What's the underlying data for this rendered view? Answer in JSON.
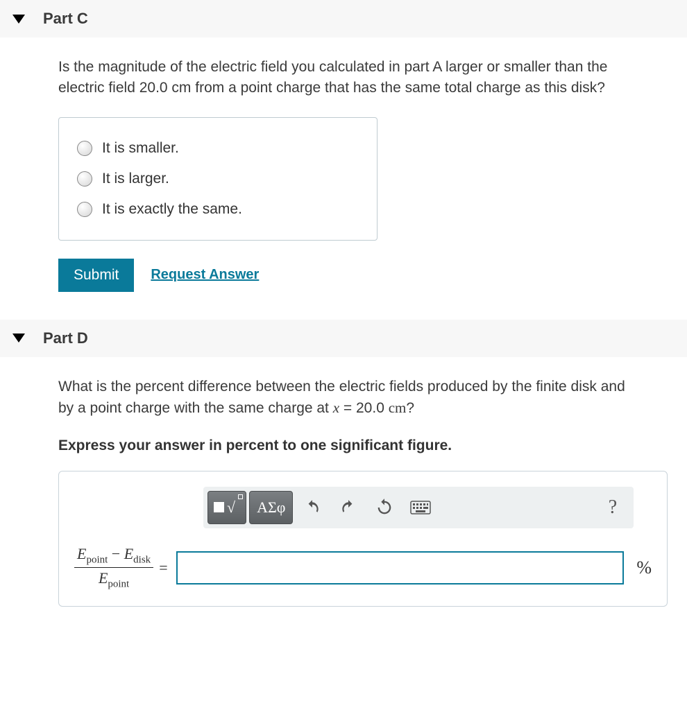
{
  "partC": {
    "label": "Part C",
    "question": "Is the magnitude of the electric field you calculated in part A larger or smaller than the electric field 20.0 cm from a point charge that has the same total charge as this disk?",
    "options": [
      "It is smaller.",
      "It is larger.",
      "It is exactly the same."
    ],
    "submit_label": "Submit",
    "request_label": "Request Answer"
  },
  "partD": {
    "label": "Part D",
    "question_pre": "What is the percent difference between the electric fields produced by the finite disk and by a point charge with the same charge at ",
    "question_var": "x",
    "question_eq": " = 20.0 ",
    "question_unit": "cm",
    "question_post": "?",
    "instruction": "Express your answer in percent to one significant figure.",
    "toolbar": {
      "greek": "ΑΣφ"
    },
    "expr": {
      "E": "E",
      "point": "point",
      "minus": " − ",
      "disk": "disk"
    },
    "equals": "=",
    "unit": "%"
  }
}
